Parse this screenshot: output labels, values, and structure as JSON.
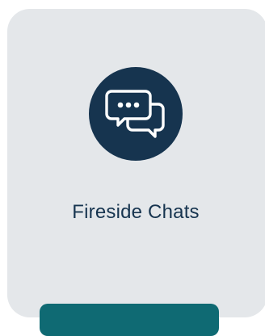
{
  "card": {
    "title": "Fireside Chats",
    "icon": "chat-bubbles-icon"
  },
  "colors": {
    "card_bg": "#e4e7ea",
    "icon_bg": "#16344f",
    "text": "#16344f",
    "button": "#0f6a73"
  }
}
